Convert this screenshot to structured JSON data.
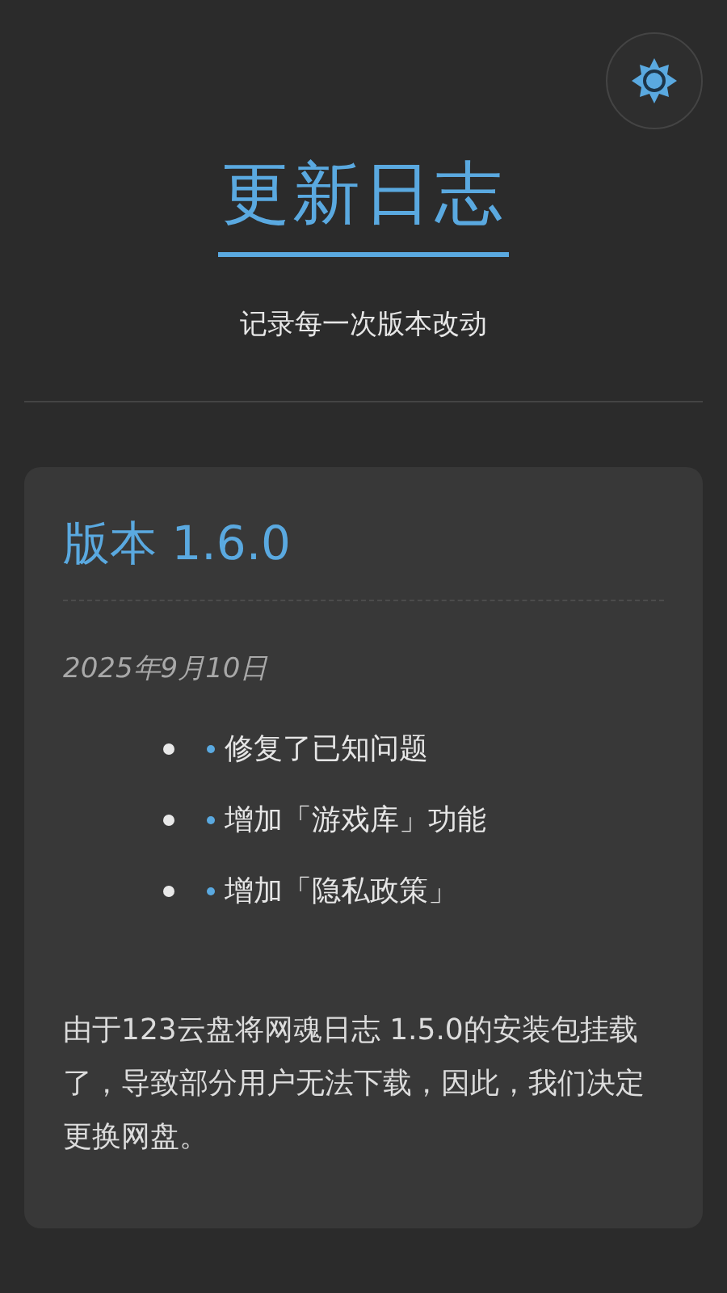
{
  "header": {
    "title": "更新日志",
    "subtitle": "记录每一次版本改动"
  },
  "releases": [
    {
      "version": "版本 1.6.0",
      "date": "2025年9月10日",
      "changes": [
        {
          "text": "修复了已知问题"
        },
        {
          "text": "增加「游戏库」功能"
        },
        {
          "text": "增加「隐私政策」"
        }
      ],
      "note": "由于123云盘将网魂日志 1.5.0的安装包挂载了，导致部分用户无法下载，因此，我们决定更换网盘。"
    }
  ]
}
